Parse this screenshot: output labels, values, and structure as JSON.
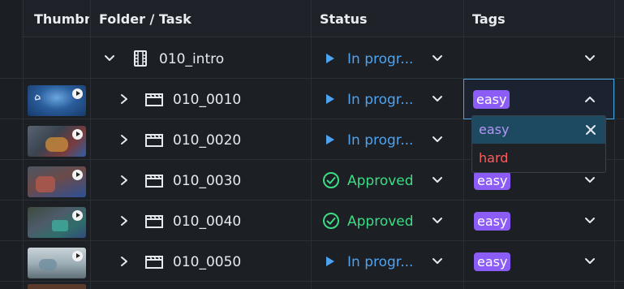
{
  "columns": {
    "thumbnail": "Thumbn",
    "folder_task": "Folder / Task",
    "status": "Status",
    "tags": "Tags"
  },
  "rows": [
    {
      "name": "010_intro",
      "type": "folder",
      "status": "",
      "status_kind": "none",
      "tag": ""
    },
    {
      "name": "010_0010",
      "type": "task",
      "status": "In progr...",
      "status_kind": "progress",
      "tag": "easy"
    },
    {
      "name": "010_0020",
      "type": "task",
      "status": "In progr...",
      "status_kind": "progress",
      "tag": ""
    },
    {
      "name": "010_0030",
      "type": "task",
      "status": "Approved",
      "status_kind": "approved",
      "tag": "easy"
    },
    {
      "name": "010_0040",
      "type": "task",
      "status": "Approved",
      "status_kind": "approved",
      "tag": "easy"
    },
    {
      "name": "010_0050",
      "type": "task",
      "status": "In progr...",
      "status_kind": "progress",
      "tag": "easy"
    }
  ],
  "intro_status": "In progr...",
  "tag_dropdown": {
    "options": [
      "easy",
      "hard"
    ],
    "selected": "easy"
  },
  "colors": {
    "progress": "#4ea3f0",
    "approved": "#3ddc84",
    "tag_easy": "#8b5cf6",
    "tag_hard": "#ff5c5c",
    "accent_border": "#4aa7e6"
  },
  "icons": {
    "folder": "film-strip-icon",
    "task": "clapperboard-icon",
    "expand": "chevron-right-icon",
    "collapse": "chevron-down-icon",
    "approved": "check-circle-icon",
    "progress": "play-triangle-icon",
    "remove": "close-icon"
  }
}
